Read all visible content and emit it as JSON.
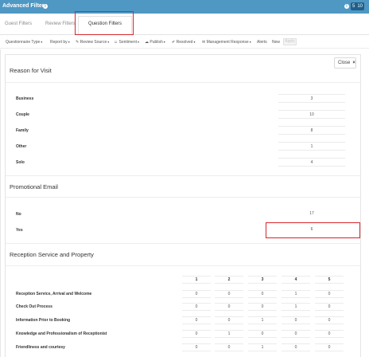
{
  "header": {
    "title": "Advanced Filters",
    "info_glyph": "i",
    "badge": [
      "5",
      "10"
    ],
    "background": "#4f98c4"
  },
  "tabs": [
    {
      "label": "Guest Filters",
      "active": false
    },
    {
      "label": "Review Filters",
      "active": false
    },
    {
      "label": "Question Filters",
      "active": true
    }
  ],
  "filters": [
    "Questionnaire Type",
    "Report by",
    "Review Source",
    "Sentiment",
    "Publish",
    "Resolved",
    "Management Response"
  ],
  "filter_plain": [
    "Alerts",
    "New"
  ],
  "filter_disabled": "Apply",
  "close_label": "Close",
  "close_glyph": "×",
  "reason_for_visit": {
    "title": "Reason for Visit",
    "rows": [
      {
        "label": "Business",
        "value": "3"
      },
      {
        "label": "Couple",
        "value": "10"
      },
      {
        "label": "Family",
        "value": "8"
      },
      {
        "label": "Other",
        "value": "1"
      },
      {
        "label": "Solo",
        "value": "4"
      }
    ]
  },
  "promotional_email": {
    "title": "Promotional Email",
    "rows": [
      {
        "label": "No",
        "value": "17"
      },
      {
        "label": "Yes",
        "value": "6"
      }
    ]
  },
  "reception": {
    "title": "Reception Service and Property",
    "columns": [
      "1",
      "2",
      "3",
      "4",
      "5"
    ],
    "rows": [
      {
        "label": "Reception Service, Arrival and Welcome",
        "values": [
          "0",
          "0",
          "0",
          "1",
          "0"
        ]
      },
      {
        "label": "Check Out Process",
        "values": [
          "0",
          "0",
          "0",
          "1",
          "0"
        ]
      },
      {
        "label": "Information Prior to Booking",
        "values": [
          "0",
          "0",
          "1",
          "0",
          "0"
        ]
      },
      {
        "label": "Knowledge and Professionalism of Receptionist",
        "values": [
          "0",
          "1",
          "0",
          "0",
          "0"
        ]
      },
      {
        "label": "Friendliness and courtesy",
        "values": [
          "0",
          "0",
          "1",
          "0",
          "0"
        ]
      }
    ]
  }
}
